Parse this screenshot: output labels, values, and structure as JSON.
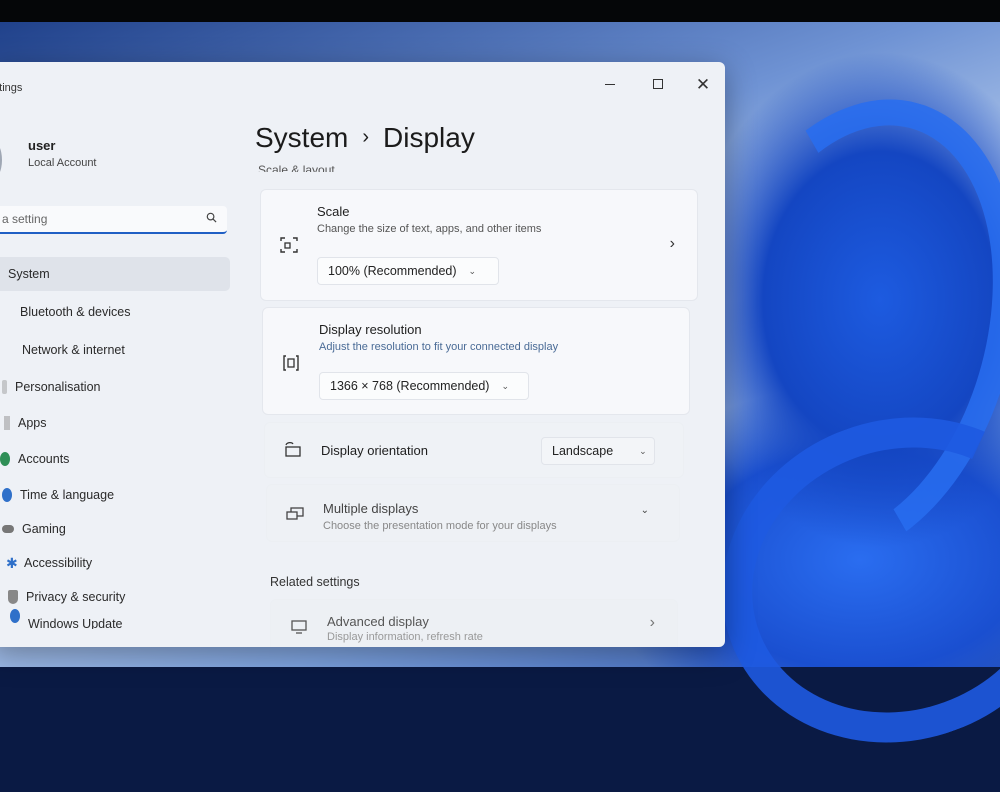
{
  "window": {
    "app_title": "ettings",
    "controls": {
      "minimize": "minimize",
      "maximize": "maximize",
      "close": "✕"
    }
  },
  "profile": {
    "name": "user",
    "account_type": "Local Account"
  },
  "search": {
    "placeholder": "a setting"
  },
  "sidebar": {
    "items": [
      {
        "label": "System",
        "icon": "system-icon",
        "selected": true
      },
      {
        "label": "Bluetooth & devices",
        "icon": "bluetooth-icon"
      },
      {
        "label": "Network & internet",
        "icon": "network-icon"
      },
      {
        "label": "Personalisation",
        "icon": "brush-icon"
      },
      {
        "label": "Apps",
        "icon": "apps-icon"
      },
      {
        "label": "Accounts",
        "icon": "accounts-icon"
      },
      {
        "label": "Time & language",
        "icon": "globe-icon"
      },
      {
        "label": "Gaming",
        "icon": "gamepad-icon"
      },
      {
        "label": "Accessibility",
        "icon": "accessibility-icon"
      },
      {
        "label": "Privacy & security",
        "icon": "shield-icon"
      },
      {
        "label": "Windows Update",
        "icon": "update-icon"
      }
    ]
  },
  "main": {
    "breadcrumb": {
      "parent": "System",
      "separator": "›",
      "current": "Display"
    },
    "section_heading": "Scale & layout",
    "scale": {
      "title": "Scale",
      "description": "Change the size of text, apps, and other items",
      "value": "100% (Recommended)"
    },
    "resolution": {
      "title": "Display resolution",
      "description": "Adjust the resolution to fit your connected display",
      "value": "1366 × 768 (Recommended)"
    },
    "orientation": {
      "title": "Display orientation",
      "value": "Landscape"
    },
    "multiple_displays": {
      "title": "Multiple displays",
      "description": "Choose the presentation mode for your displays"
    },
    "related_settings": "Related settings",
    "advanced_display": {
      "title": "Advanced display",
      "description": "Display information, refresh rate"
    }
  },
  "colors": {
    "accent": "#1f5fc4",
    "window_bg": "#eef1f6",
    "wallpaper": "#1d5be0"
  }
}
